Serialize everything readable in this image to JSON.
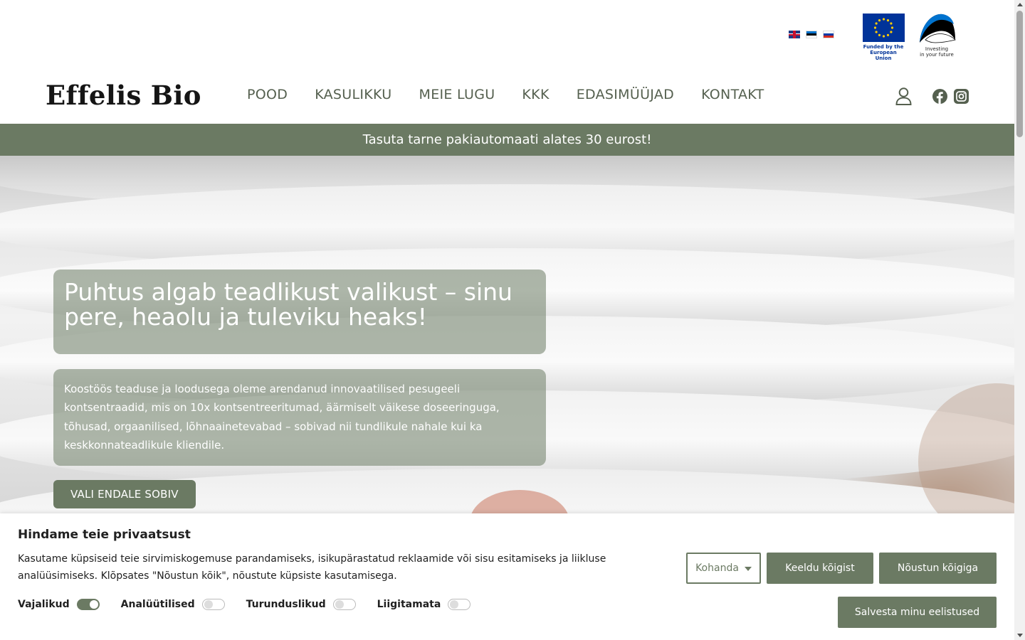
{
  "brand": {
    "name": "Effelis Bio"
  },
  "languages": [
    {
      "code": "en",
      "icon": "uk-flag-icon"
    },
    {
      "code": "et",
      "icon": "estonia-flag-icon"
    },
    {
      "code": "ru",
      "icon": "russia-flag-icon"
    }
  ],
  "funding": {
    "eu_text_1": "Funded by the",
    "eu_text_2": "European Union",
    "ee_text_1": "Investing",
    "ee_text_2": "in your future"
  },
  "nav": {
    "items": [
      "POOD",
      "KASULIKKU",
      "MEIE LUGU",
      "KKK",
      "EDASIMÜÜJAD",
      "KONTAKT"
    ]
  },
  "header_icons": [
    "user-icon",
    "facebook-icon",
    "instagram-icon"
  ],
  "promo": {
    "text": "Tasuta tarne pakiautomaati alates 30 eurost!"
  },
  "hero": {
    "title": "Puhtus algab teadlikust valikust – sinu pere, heaolu ja tuleviku heaks!",
    "text": "Koostöös teaduse ja loodusega oleme arendanud innovaatilised pesugeeli kontsentraadid, mis on 10x kontsentreeritumad, äärmiselt väikese doseeringuga, tõhusad, orgaanilised, lõhnaainetevabad – sobivad nii tundlikule nahale kui ka keskkonnateadlikule kliendile.",
    "button": "VALI ENDALE SOBIV"
  },
  "cookie": {
    "title": "Hindame teie privaatsust",
    "text": "Kasutame küpsiseid teie sirvimiskogemuse parandamiseks, isikupärastatud reklaamide või sisu esitamiseks ja liikluse analüüsimiseks. Klõpsates \"Nõustun kõik\", nõustute küpsiste kasutamisega.",
    "toggles": [
      {
        "label": "Vajalikud",
        "on": true
      },
      {
        "label": "Analüütilised",
        "on": false
      },
      {
        "label": "Turunduslikud",
        "on": false
      },
      {
        "label": "Liigitamata",
        "on": false
      }
    ],
    "customize": "Kohanda",
    "reject": "Keeldu kõigist",
    "accept": "Nõustun kõigiga",
    "save": "Salvesta minu eelistused"
  },
  "colors": {
    "accent": "#6b7a63",
    "nav_text": "#55604f"
  }
}
